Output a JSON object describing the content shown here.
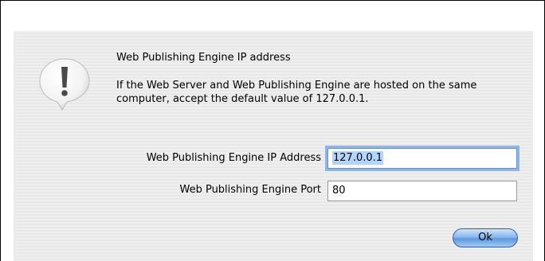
{
  "dialog": {
    "icon": "alert-exclamation-icon",
    "title": "Web Publishing Engine IP address",
    "message": "If the Web Server and Web Publishing Engine are hosted on the same computer, accept the default value of 127.0.0.1.",
    "fields": {
      "ip_label": "Web Publishing Engine IP Address",
      "ip_value": "127.0.0.1",
      "port_label": "Web Publishing Engine Port",
      "port_value": "80"
    },
    "ok_label": "Ok"
  },
  "colors": {
    "focus_ring": "#8fb4e8",
    "selection": "#b5d3ff",
    "button_blue": "#5f97df"
  }
}
